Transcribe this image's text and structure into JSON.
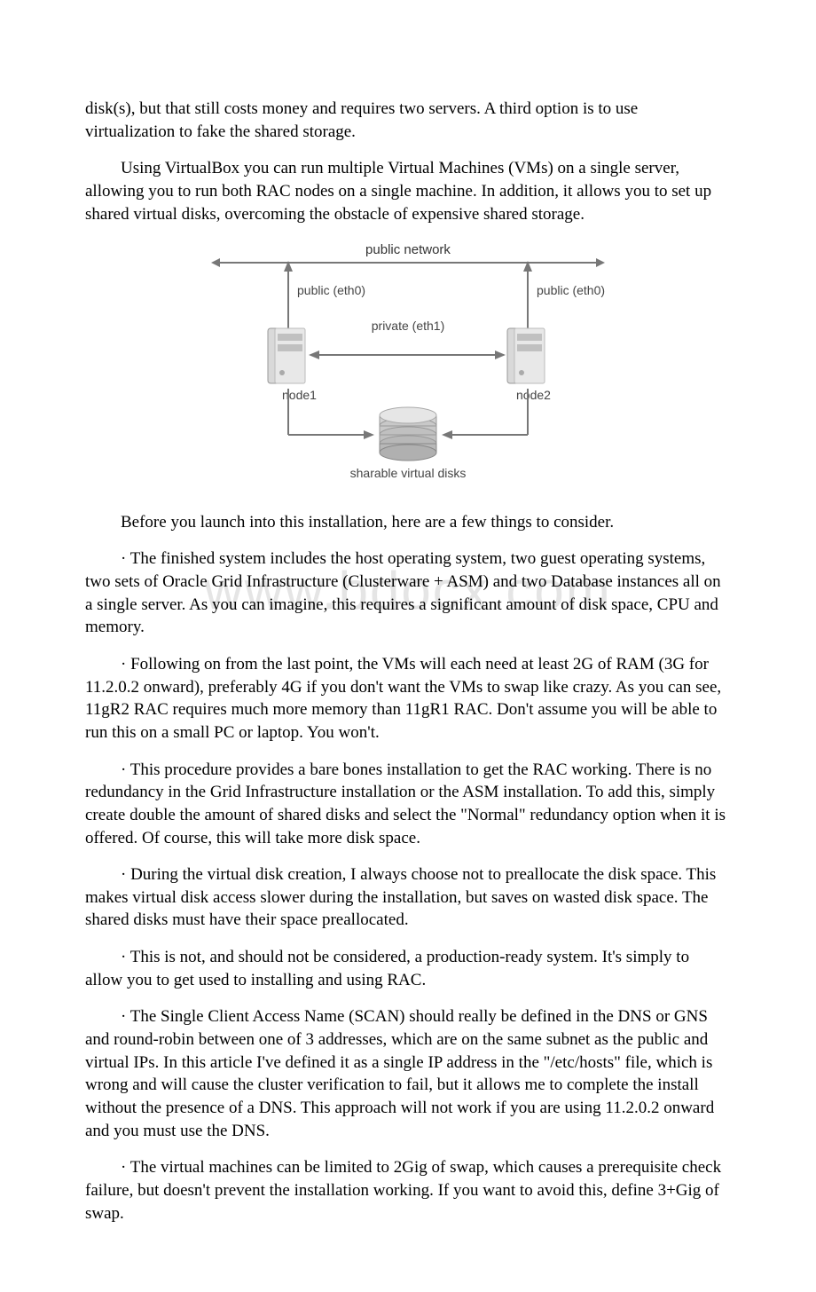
{
  "paragraphs": {
    "p1": "disk(s), but that still costs money and requires two servers. A third option is to use virtualization to fake the shared storage.",
    "p2": "Using VirtualBox you can run multiple Virtual Machines (VMs) on a single server, allowing you to run both RAC nodes on a single machine. In addition, it allows you to set up shared virtual disks, overcoming the obstacle of expensive shared storage.",
    "p3": "Before you launch into this installation, here are a few things to consider.",
    "b1": "· The finished system includes the host operating system, two guest operating systems, two sets of Oracle Grid Infrastructure (Clusterware + ASM) and two Database instances all on a single server. As you can imagine, this requires a significant amount of disk space, CPU and memory.",
    "b2": "· Following on from the last point, the VMs will each need at least 2G of RAM (3G for 11.2.0.2 onward), preferably 4G if you don't want the VMs to swap like crazy. As you can see, 11gR2 RAC requires much more memory than 11gR1 RAC. Don't assume you will be able to run this on a small PC or laptop. You won't.",
    "b3": "· This procedure provides a bare bones installation to get the RAC working. There is no redundancy in the Grid Infrastructure installation or the ASM installation. To add this, simply create double the amount of shared disks and select the \"Normal\" redundancy option when it is offered. Of course, this will take more disk space.",
    "b4": "· During the virtual disk creation, I always choose not to preallocate the disk space. This makes virtual disk access slower during the installation, but saves on wasted disk space. The shared disks must have their space preallocated.",
    "b5": "· This is not, and should not be considered, a production-ready system. It's simply to allow you to get used to installing and using RAC.",
    "b6": "· The Single Client Access Name (SCAN) should really be defined in the DNS or GNS and round-robin between one of 3 addresses, which are on the same subnet as the public and virtual IPs. In this article I've defined it as a single IP address in the \"/etc/hosts\" file, which is wrong and will cause the cluster verification to fail, but it allows me to complete the install without the presence of a DNS. This approach will not work if you are using 11.2.0.2 onward and you must use the DNS.",
    "b7": "· The virtual machines can be limited to 2Gig of swap, which causes a prerequisite check failure, but doesn't prevent the installation working. If you want to avoid this, define 3+Gig of swap."
  },
  "diagram": {
    "public_network": "public network",
    "public_eth0_left": "public (eth0)",
    "public_eth0_right": "public (eth0)",
    "private_eth1": "private (eth1)",
    "node1": "node1",
    "node2": "node2",
    "shared_disks": "sharable virtual disks"
  },
  "watermark": "www.bdocx.com"
}
